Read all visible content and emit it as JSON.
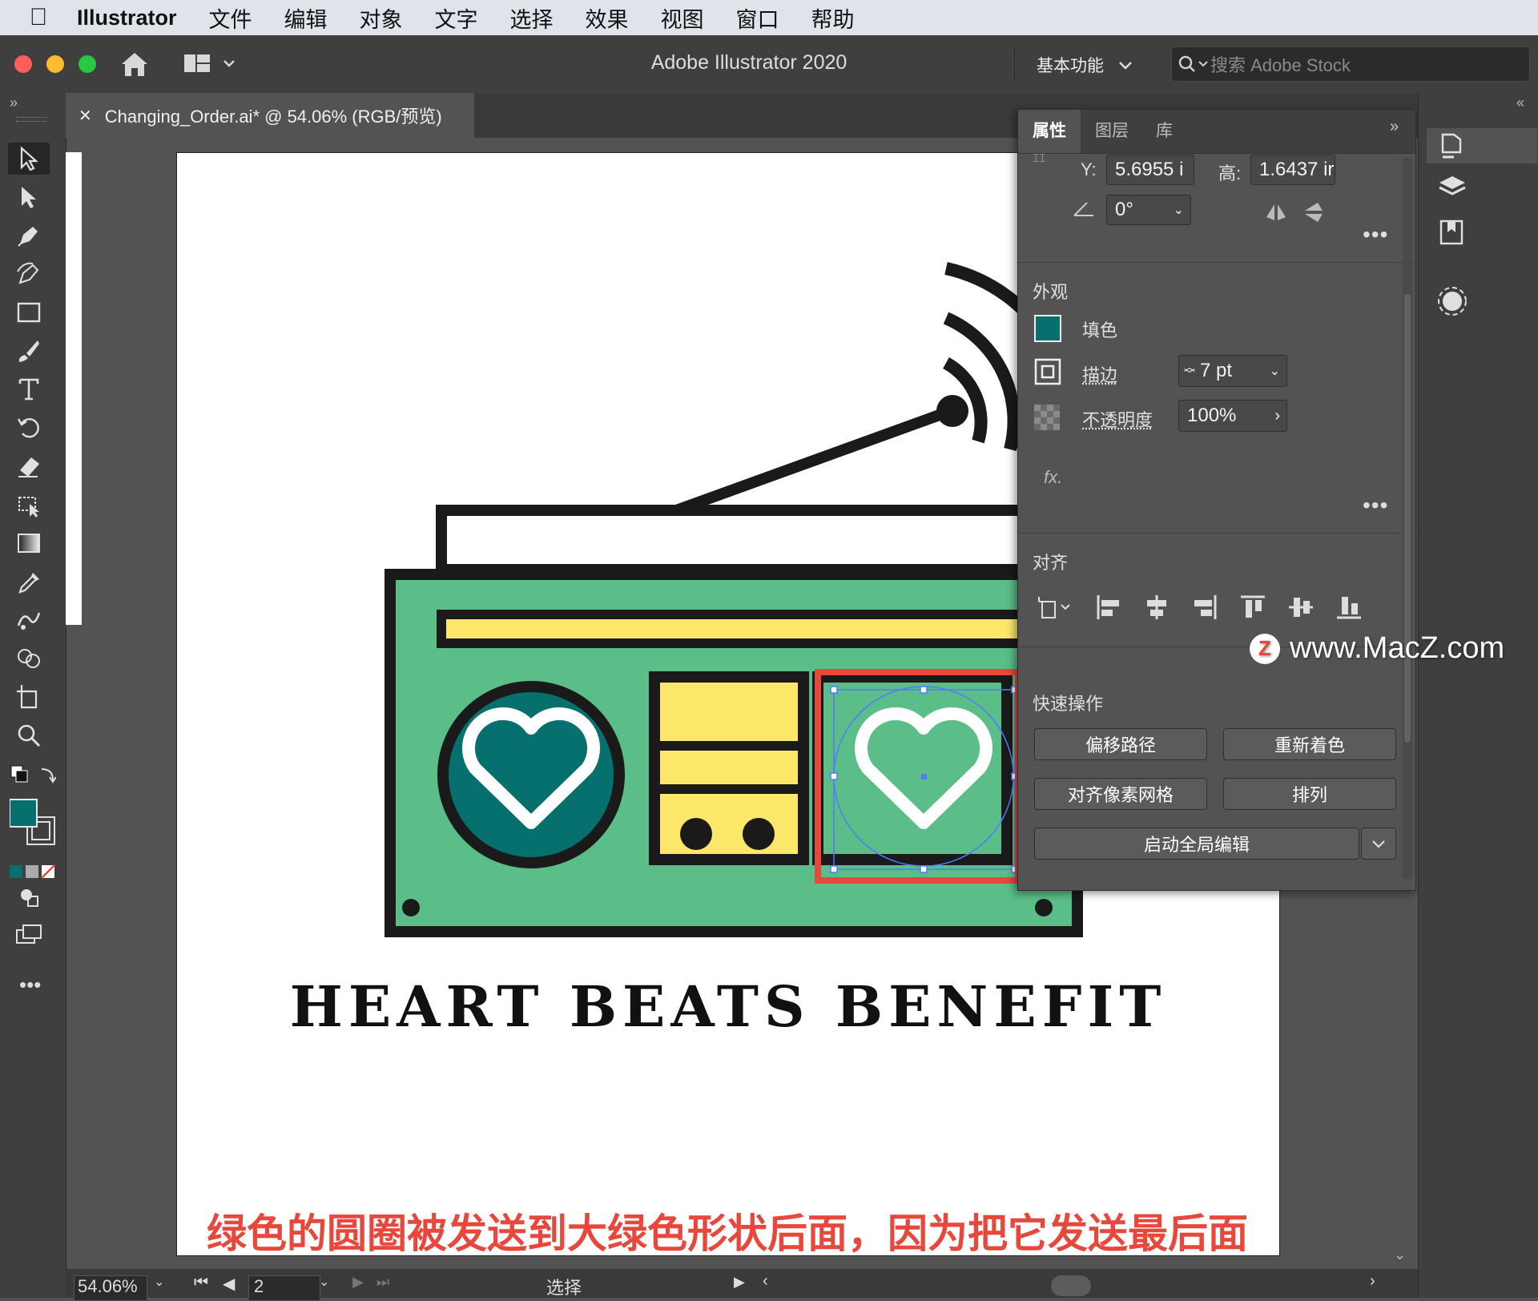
{
  "menubar": {
    "app": "Illustrator",
    "items": [
      "文件",
      "编辑",
      "对象",
      "文字",
      "选择",
      "效果",
      "视图",
      "窗口",
      "帮助"
    ]
  },
  "appbar": {
    "title": "Adobe Illustrator 2020",
    "workspace": "基本功能",
    "stock_placeholder": "搜索 Adobe Stock"
  },
  "document": {
    "tab_label": "Changing_Order.ai* @ 54.06% (RGB/预览)"
  },
  "artwork": {
    "headline": "HEART BEATS BENEFIT"
  },
  "props": {
    "tabs": [
      "属性",
      "图层",
      "库"
    ],
    "transform": {
      "y_label": "Y:",
      "y_value": "5.6955 i",
      "h_label": "高:",
      "h_value": "1.6437 ir",
      "angle_value": "0°"
    },
    "appearance": {
      "title": "外观",
      "fill_label": "填色",
      "stroke_label": "描边",
      "stroke_value": "7 pt",
      "opacity_label": "不透明度",
      "opacity_value": "100%",
      "fx_label": "fx."
    },
    "align": {
      "title": "对齐"
    },
    "quick_actions": {
      "title": "快速操作",
      "offset_path": "偏移路径",
      "recolor": "重新着色",
      "align_pixel_grid": "对齐像素网格",
      "arrange": "排列",
      "global_edit": "启动全局编辑"
    }
  },
  "status": {
    "zoom": "54.06%",
    "artboard_no": "2",
    "tool_name": "选择"
  },
  "overlay": {
    "caption": "绿色的圆圈被发送到大绿色形状后面，因为把它发送最后面",
    "watermark": "www.MacZ.com",
    "watermark_badge": "Z"
  },
  "colors": {
    "fill": "#05706e",
    "green": "#5bbd88",
    "yellow": "#fde769",
    "highlight": "#e8473b"
  }
}
